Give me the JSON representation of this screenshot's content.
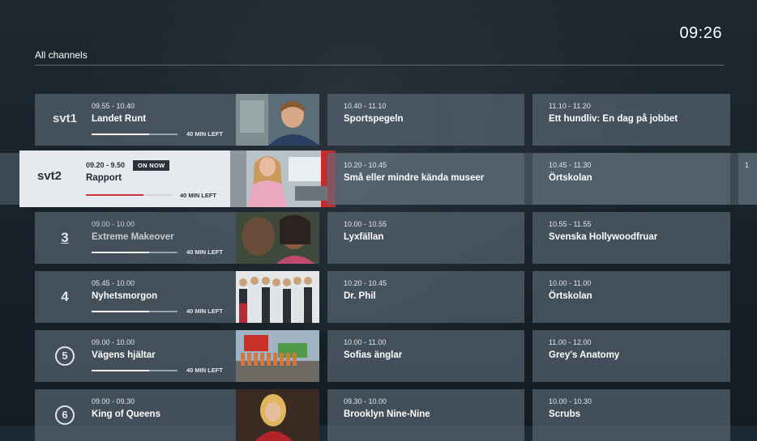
{
  "header": {
    "clock": "09:26",
    "title": "All channels"
  },
  "rows": [
    {
      "channel_logo": "svt1",
      "current": {
        "time": "09.55 - 10.40",
        "title": "Landet Runt",
        "progress": 0.67,
        "time_left": "40 MIN LEFT"
      },
      "next": [
        {
          "time": "10.40 - 11.10",
          "title": "Sportspegeln"
        },
        {
          "time": "11.10 - 11.20",
          "title": "Ett hundliv: En dag på jobbet"
        }
      ]
    },
    {
      "channel_logo": "svt2",
      "focused": true,
      "badge": "ON NOW",
      "current": {
        "time": "09.20 - 9.50",
        "title": "Rapport",
        "progress": 0.67,
        "time_left": "40 MIN LEFT"
      },
      "next": [
        {
          "time": "10.20 - 10.45",
          "title": "Små eller mindre kända museer"
        },
        {
          "time": "10.45 - 11.30",
          "title": "Örtskolan"
        },
        {
          "time": "1"
        }
      ]
    },
    {
      "channel_logo": "3",
      "current": {
        "time": "09.00 - 10.00",
        "title": "Extreme Makeover",
        "progress": 0.67,
        "time_left": "40 MIN LEFT"
      },
      "next": [
        {
          "time": "10.00 - 10.55",
          "title": "Lyxfällan"
        },
        {
          "time": "10.55 - 11.55",
          "title": "Svenska Hollywoodfruar"
        }
      ]
    },
    {
      "channel_logo": "4",
      "current": {
        "time": "05.45 - 10.00",
        "title": "Nyhetsmorgon",
        "progress": 0.67,
        "time_left": "40 MIN LEFT"
      },
      "next": [
        {
          "time": "10.20 - 10.45",
          "title": "Dr. Phil"
        },
        {
          "time": "10.00 - 11.00",
          "title": "Örtskolan"
        }
      ]
    },
    {
      "channel_logo": "5",
      "current": {
        "time": "09.00 - 10.00",
        "title": "Vägens hjältar",
        "progress": 0.67,
        "time_left": "40 MIN LEFT"
      },
      "next": [
        {
          "time": "10.00 - 11.00",
          "title": "Sofias änglar"
        },
        {
          "time": "11.00 - 12.00",
          "title": "Grey's Anatomy"
        }
      ]
    },
    {
      "channel_logo": "6",
      "current": {
        "time": "09.00 - 09.30",
        "title": "King of Queens"
      },
      "next": [
        {
          "time": "09.30 - 10.00",
          "title": "Brooklyn Nine-Nine"
        },
        {
          "time": "10.00 - 10.30",
          "title": "Scrubs"
        }
      ]
    }
  ],
  "colors": {
    "accent_progress": "#d0343f",
    "tile": "#606e7a",
    "focus_tile": "#e6eaee"
  },
  "icons": [
    "svt1-logo-icon",
    "svt2-logo-icon",
    "channel-3-logo-icon",
    "channel-4-logo-icon",
    "channel-5-logo-icon",
    "channel-6-logo-icon"
  ]
}
